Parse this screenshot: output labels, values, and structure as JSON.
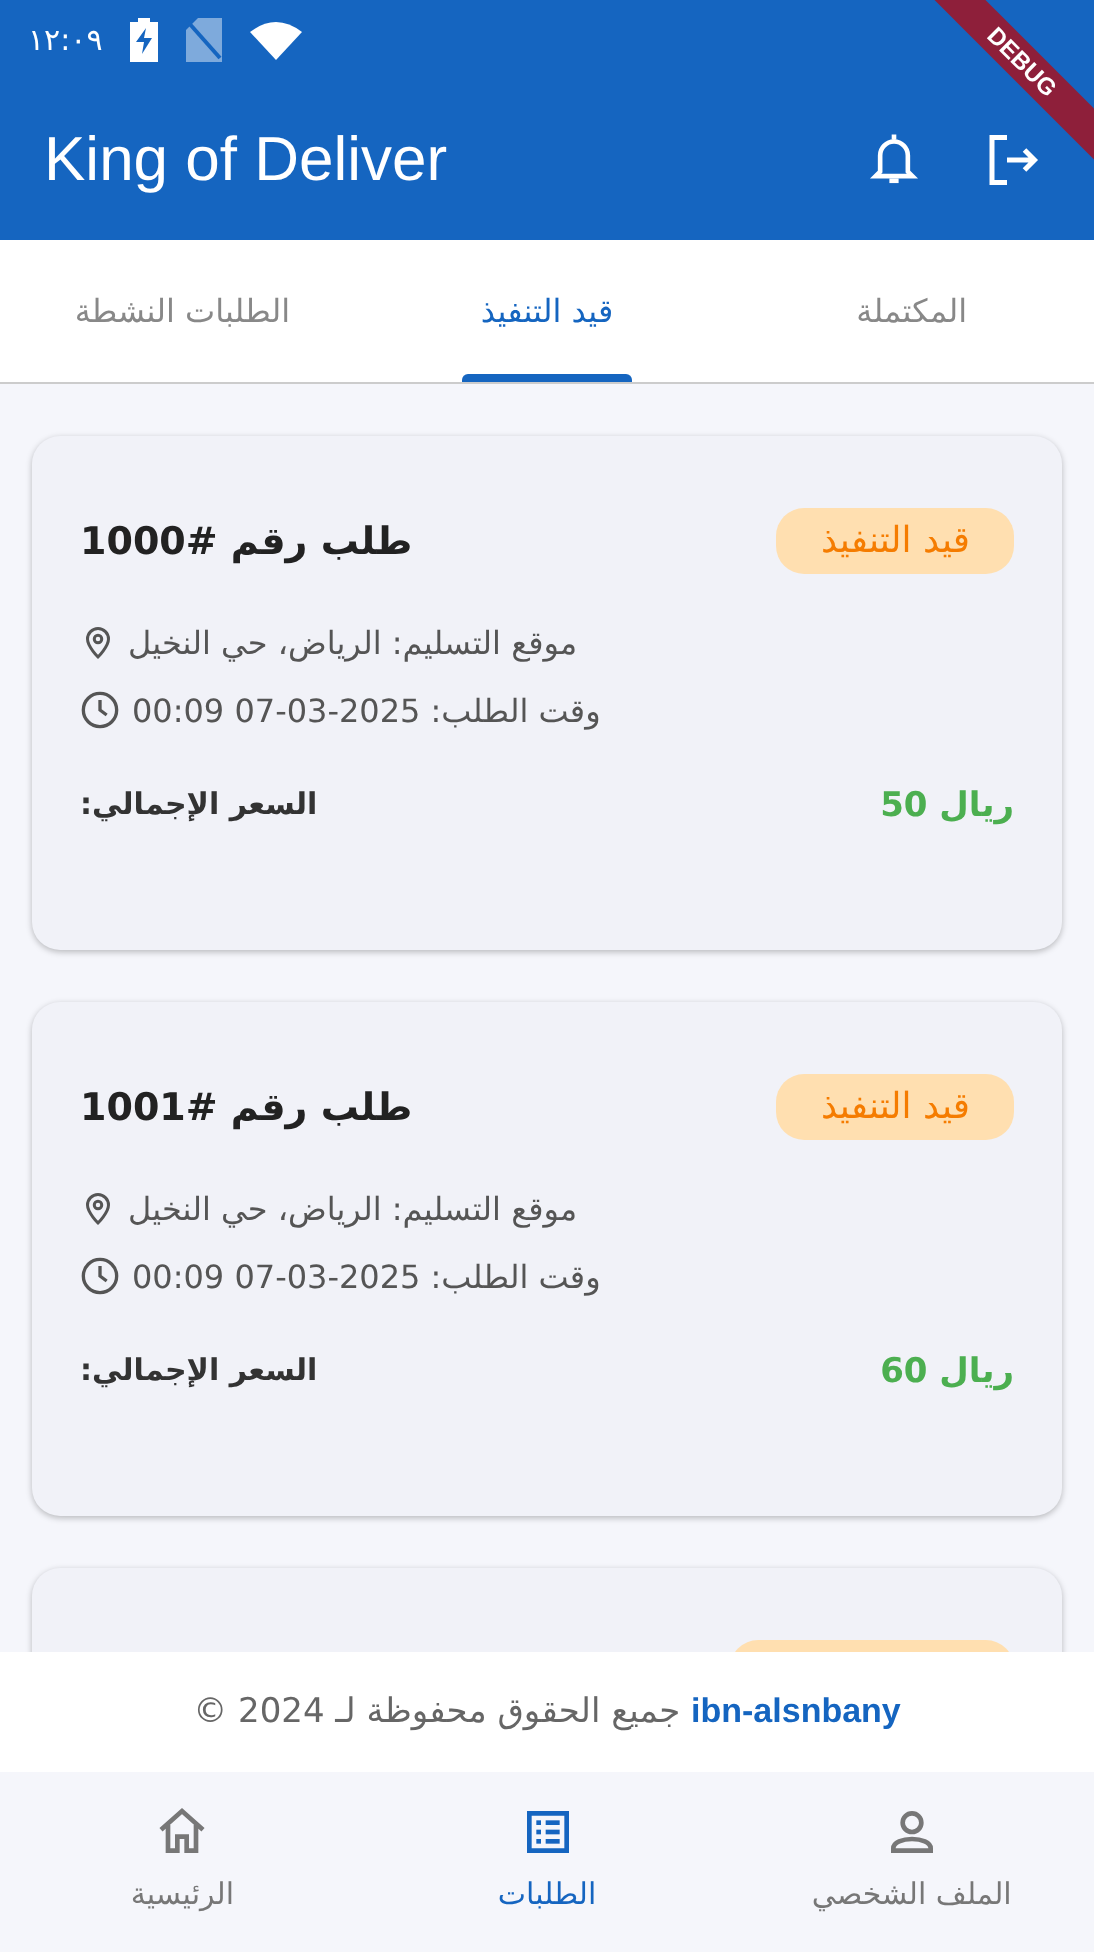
{
  "status_bar": {
    "time": "١٢:٠٩"
  },
  "app_bar": {
    "title": "King of Deliver",
    "debug_banner": "DEBUG"
  },
  "tabs": [
    {
      "label": "المكتملة",
      "selected": false
    },
    {
      "label": "قيد التنفيذ",
      "selected": true
    },
    {
      "label": "الطلبات النشطة",
      "selected": false
    }
  ],
  "orders": [
    {
      "title": "طلب رقم #1000",
      "status": "قيد التنفيذ",
      "location": "موقع التسليم: الرياض، حي النخيل",
      "time": "وقت الطلب: 2025-03-07 00:09",
      "price": "ريال 50",
      "price_label": "السعر الإجمالي:"
    },
    {
      "title": "طلب رقم #1001",
      "status": "قيد التنفيذ",
      "location": "موقع التسليم: الرياض، حي النخيل",
      "time": "وقت الطلب: 2025-03-07 00:09",
      "price": "ريال 60",
      "price_label": "السعر الإجمالي:"
    }
  ],
  "more_orders_below": true,
  "footer": {
    "link": "ibn-alsnbany",
    "text": "جميع الحقوق محفوظة لـ 2024 ©"
  },
  "bottom_nav": [
    {
      "kind": "profile",
      "label": "الملف الشخصي",
      "selected": false
    },
    {
      "kind": "orders",
      "label": "الطلبات",
      "selected": true
    },
    {
      "kind": "home",
      "label": "الرئيسية",
      "selected": false
    }
  ]
}
